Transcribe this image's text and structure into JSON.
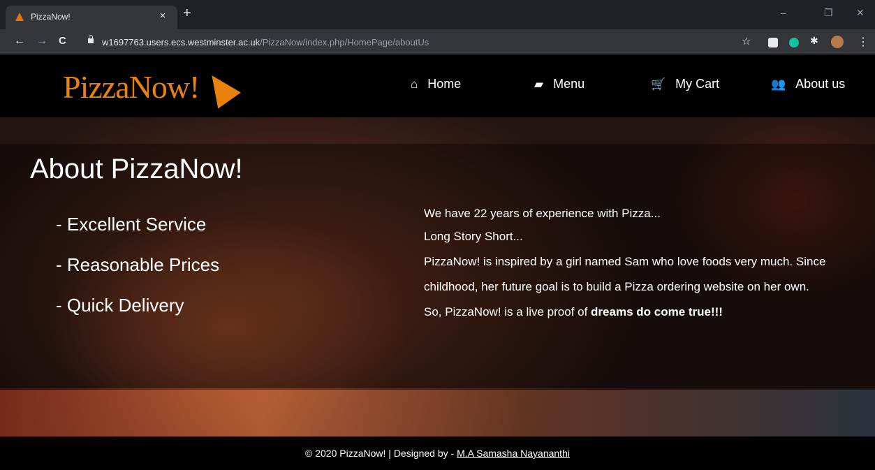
{
  "browser": {
    "tab_title": "PizzaNow!",
    "tab_close": "×",
    "new_tab": "+",
    "url_host": "w1697763.users.ecs.westminster.ac.uk",
    "url_path": "/PizzaNow/index.php/HomePage/aboutUs",
    "controls": {
      "minimize": "–",
      "restore": "❐",
      "close": "✕"
    },
    "nav": {
      "back": "←",
      "forward": "→",
      "reload": "C"
    }
  },
  "site": {
    "logo_text": "PizzaNow!",
    "brand_color": "#e8820c",
    "nav": [
      {
        "label": "Home",
        "icon": "home-icon",
        "glyph": "⌂"
      },
      {
        "label": "Menu",
        "icon": "book-icon",
        "glyph": "▰"
      },
      {
        "label": "My Cart",
        "icon": "cart-icon",
        "glyph": "🛒"
      },
      {
        "label": "About us",
        "icon": "users-icon",
        "glyph": "👥"
      }
    ]
  },
  "about": {
    "title": "About PizzaNow!",
    "features": [
      "- Excellent Service",
      "- Reasonable Prices",
      "- Quick Delivery"
    ],
    "line1": "We have 22 years of experience with Pizza...",
    "line2": "Long Story Short...",
    "para": "PizzaNow! is inspired by a girl named Sam who love foods very much. Since childhood, her future goal is to build a Pizza ordering website on her own. So, PizzaNow! is a live proof of ",
    "para_bold": "dreams do come true!!!"
  },
  "footer": {
    "text": "© 2020 PizzaNow! | Designed by - ",
    "designer": "M.A Samasha Nayananthi"
  }
}
